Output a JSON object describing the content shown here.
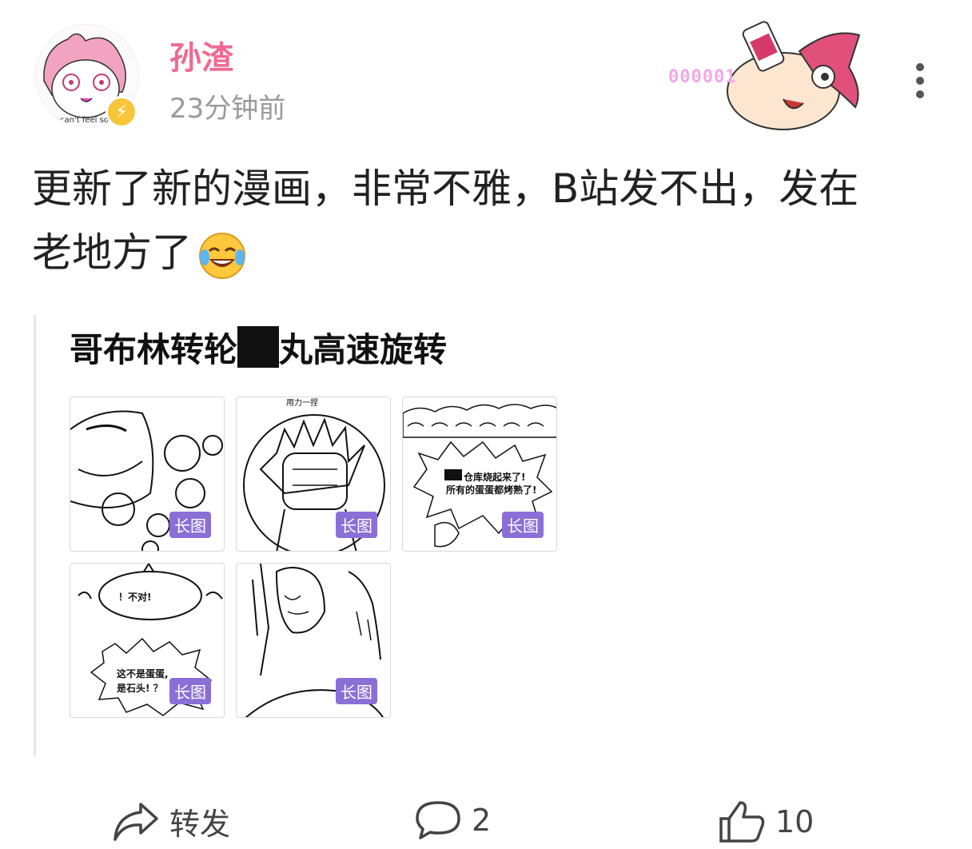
{
  "user": {
    "name": "孙渣",
    "time": "23分钟前",
    "avatar_caption": "can't feel so",
    "pendant_text": "000001"
  },
  "post": {
    "text_line1": "更新了新的漫画，非常不雅，B站发不出，发在",
    "text_line2": "老地方了"
  },
  "card": {
    "title_before": "哥布林转轮",
    "title_after": "丸高速旋转",
    "thumbnails": [
      {
        "tag": "长图",
        "panel_text": [
          "用力一捏"
        ]
      },
      {
        "tag": "长图",
        "panel_text": []
      },
      {
        "tag": "长图",
        "panel_text": [
          "仓库烧起来了!",
          "所有的蛋蛋都烤熟了!"
        ]
      },
      {
        "tag": "长图",
        "panel_text": [
          "！不对!",
          "这不是蛋蛋,",
          "是石头! ？"
        ]
      },
      {
        "tag": "长图",
        "panel_text": []
      }
    ]
  },
  "actions": {
    "repost_label": "转发",
    "comment_count": "2",
    "like_count": "10"
  },
  "colors": {
    "username": "#ef6a93",
    "tag_bg": "#8a6fd6",
    "badge": "#f6c53a"
  }
}
